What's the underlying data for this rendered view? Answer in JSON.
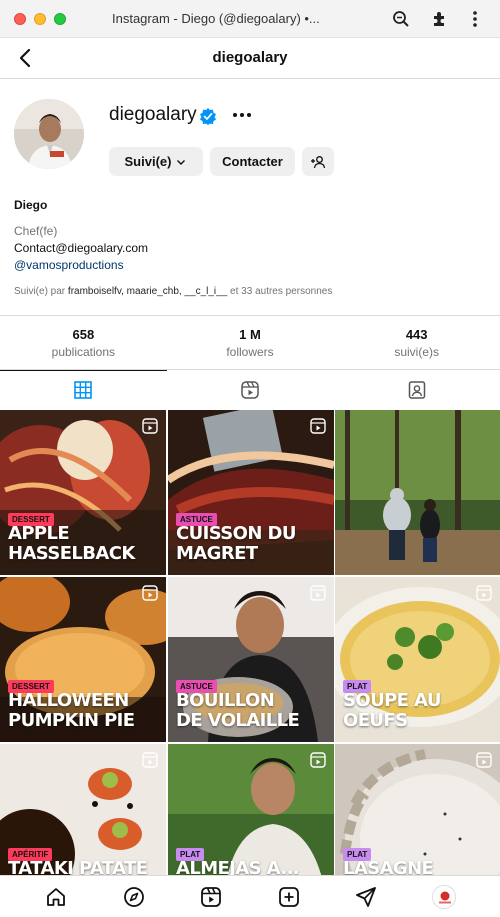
{
  "window": {
    "title": "Instagram - Diego (@diegoalary) •..."
  },
  "header": {
    "title": "diegoalary"
  },
  "profile": {
    "username": "diegoalary",
    "follow_label": "Suivi(e)",
    "contact_label": "Contacter",
    "name": "Diego",
    "category": "Chef(fe)",
    "contact": "Contact@diegoalary.com",
    "link": "@vamosproductions",
    "followed_by": {
      "prefix": "Suivi(e) par",
      "names": "framboiselfv, maarie_chb, __c_l_i__",
      "suffix": "et 33 autres personnes"
    }
  },
  "stats": [
    {
      "value": "658",
      "label": "publications"
    },
    {
      "value": "1 M",
      "label": "followers"
    },
    {
      "value": "443",
      "label": "suivi(e)s"
    }
  ],
  "tabs": [
    "posts-grid-icon",
    "reels-icon",
    "tagged-icon"
  ],
  "posts": [
    {
      "badge": "DESSERT",
      "title_lines": [
        "APPLE",
        "HASSELBACK"
      ],
      "badge_color": "#ff3b5c",
      "badge_text_color": "#111"
    },
    {
      "badge": "ASTUCE",
      "title_lines": [
        "CUISSON DU",
        "MAGRET"
      ],
      "badge_color": "#e94fb0",
      "badge_text_color": "#111"
    },
    {
      "badge": "",
      "title_lines": [],
      "badge_color": "",
      "badge_text_color": ""
    },
    {
      "badge": "DESSERT",
      "title_lines": [
        "HALLOWEEN",
        "PUMPKIN PIE"
      ],
      "badge_color": "#ff3b5c",
      "badge_text_color": "#111"
    },
    {
      "badge": "ASTUCE",
      "title_lines": [
        "BOUILLON",
        "DE VOLAILLE"
      ],
      "badge_color": "#e94fb0",
      "badge_text_color": "#111"
    },
    {
      "badge": "PLAT",
      "title_lines": [
        "SOUPE AU",
        "OEUFS"
      ],
      "badge_color": "#c88cf0",
      "badge_text_color": "#111"
    },
    {
      "badge": "APÉRITIF",
      "title_lines": [
        "TATAKI PATATE"
      ],
      "badge_color": "#ff3b5c",
      "badge_text_color": "#111"
    },
    {
      "badge": "PLAT",
      "title_lines": [
        "ALMEJAS A..."
      ],
      "badge_color": "#c88cf0",
      "badge_text_color": "#111"
    },
    {
      "badge": "PLAT",
      "title_lines": [
        "LASAGNE"
      ],
      "badge_color": "#c88cf0",
      "badge_text_color": "#111"
    }
  ],
  "bottom_nav": [
    "home-icon",
    "explore-icon",
    "reels-icon",
    "create-icon",
    "messages-icon",
    "profile-avatar"
  ],
  "colors": {
    "verified": "#0095f6",
    "link": "#00376b",
    "button_bg": "#efefef"
  }
}
